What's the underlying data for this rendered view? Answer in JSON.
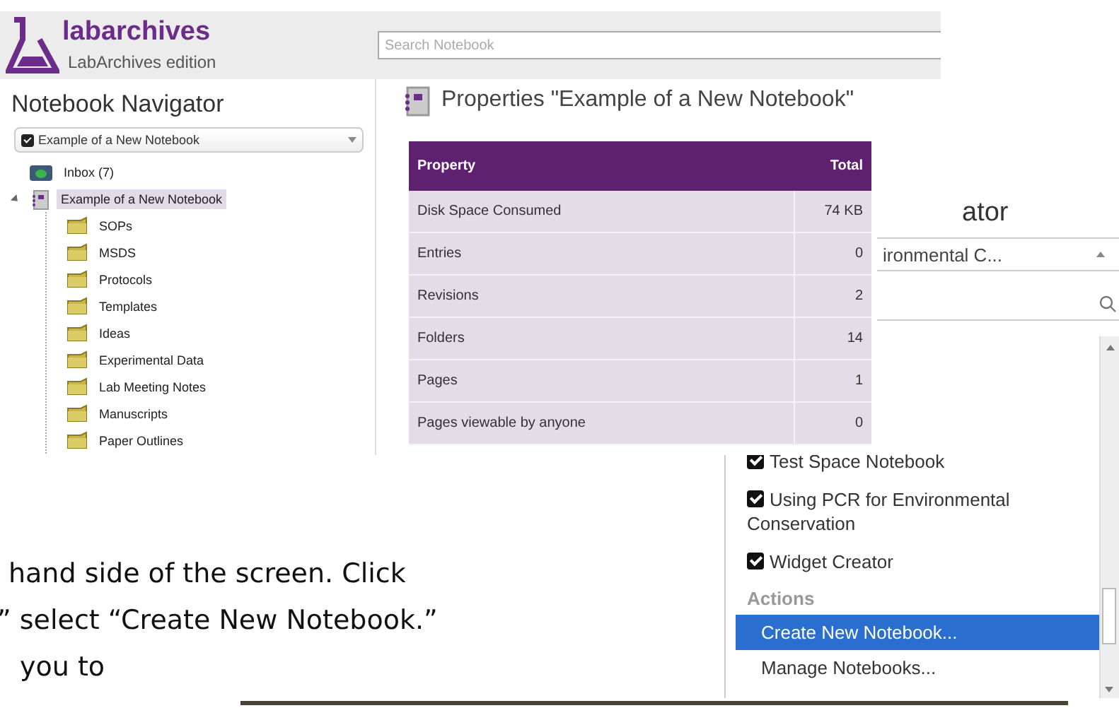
{
  "app": {
    "logo_name": "labarchives",
    "edition": "LabArchives edition",
    "search": {
      "placeholder": "Search Notebook"
    }
  },
  "navigator": {
    "title": "Notebook Navigator",
    "notebook_select": {
      "value": "Example of a New Notebook"
    },
    "tree": [
      {
        "label": "Inbox (7)",
        "kind": "inbox",
        "selected": false
      },
      {
        "label": "Example of a New Notebook",
        "kind": "notebook",
        "selected": true,
        "expanded": true,
        "children": [
          {
            "label": "SOPs",
            "kind": "folder",
            "selected": false
          },
          {
            "label": "MSDS",
            "kind": "folder",
            "selected": false
          },
          {
            "label": "Protocols",
            "kind": "folder",
            "selected": false
          },
          {
            "label": "Templates",
            "kind": "folder",
            "selected": false
          },
          {
            "label": "Ideas",
            "kind": "folder",
            "selected": false
          },
          {
            "label": "Experimental Data",
            "kind": "folder",
            "selected": false
          },
          {
            "label": "Lab Meeting Notes",
            "kind": "folder",
            "selected": false
          },
          {
            "label": "Manuscripts",
            "kind": "folder",
            "selected": false
          },
          {
            "label": "Paper Outlines",
            "kind": "folder",
            "selected": false
          }
        ]
      }
    ]
  },
  "properties": {
    "title": "Properties \"Example of a New Notebook\"",
    "columns": [
      "Property",
      "Total"
    ],
    "rows": [
      [
        "Disk Space Consumed",
        "74 KB"
      ],
      [
        "Entries",
        "0"
      ],
      [
        "Revisions",
        "2"
      ],
      [
        "Folders",
        "14"
      ],
      [
        "Pages",
        "1"
      ],
      [
        "Pages viewable by anyone",
        "0"
      ]
    ]
  },
  "second_navigator": {
    "title": "ator",
    "notebook_select": {
      "value": "ironmental C..."
    },
    "notebooks": [
      {
        "label": "Test Space Notebook",
        "checked": true
      },
      {
        "label": "Using PCR for Environmental Conservation",
        "checked": true
      },
      {
        "label": "Widget Creator",
        "checked": true
      }
    ],
    "actions_heading": "Actions",
    "actions": [
      {
        "label": "Create New Notebook...",
        "selected": true
      },
      {
        "label": "Manage Notebooks...",
        "selected": false
      }
    ]
  },
  "document_text": [
    "hand side of the screen. Click",
    "” select “Create New Notebook.”",
    "you to"
  ]
}
